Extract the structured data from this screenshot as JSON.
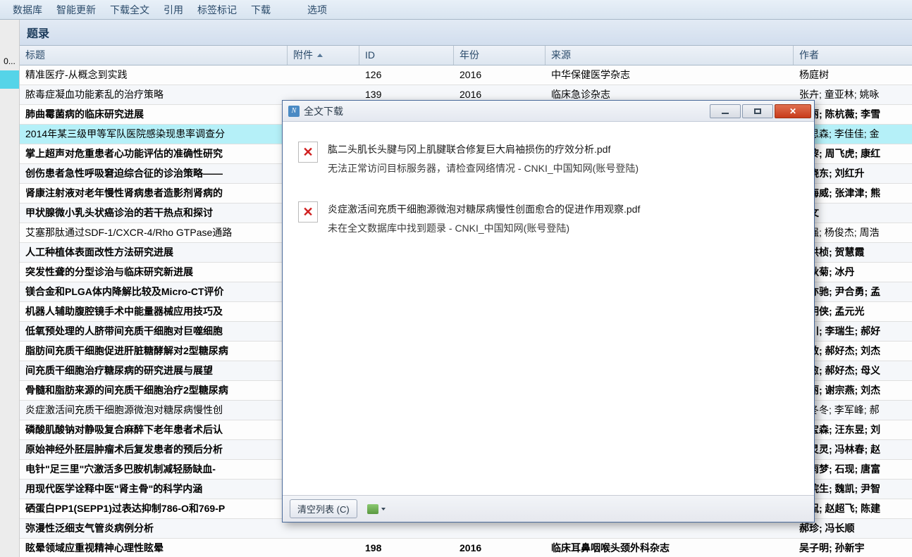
{
  "menu": {
    "items": [
      "数据库",
      "智能更新",
      "下载全文",
      "引用",
      "标签标记",
      "下载",
      "选项"
    ]
  },
  "sidebar": {
    "label": "0..."
  },
  "section": {
    "title": "题录"
  },
  "table": {
    "columns": {
      "title": "标题",
      "attachment": "附件",
      "id": "ID",
      "year": "年份",
      "source": "来源",
      "author": "作者"
    },
    "rows": [
      {
        "bold": false,
        "highlight": false,
        "title": "精准医疗-从概念到实践",
        "att": "",
        "id": "126",
        "year": "2016",
        "source": "中华保健医学杂志",
        "author": "杨庭树"
      },
      {
        "bold": false,
        "highlight": false,
        "title": "脓毒症凝血功能紊乱的治疗策略",
        "att": "",
        "id": "139",
        "year": "2016",
        "source": "临床急诊杂志",
        "author": "张卉; 童亚林; 姚咏"
      },
      {
        "bold": true,
        "highlight": false,
        "title": "肺曲霉菌病的临床研究进展",
        "att": "",
        "id": "",
        "year": "",
        "source": "",
        "author": "马丽; 陈杭薇; 李雪"
      },
      {
        "bold": false,
        "highlight": true,
        "title": "2014年某三级甲等军队医院感染现患率调查分",
        "att": "",
        "id": "",
        "year": "",
        "source": "",
        "author": "王思森; 李佳佳; 金"
      },
      {
        "bold": true,
        "highlight": false,
        "title": "掌上超声对危重患者心功能评估的准确性研究",
        "att": "",
        "id": "",
        "year": "",
        "source": "",
        "author": "王黎; 周飞虎; 康红"
      },
      {
        "bold": true,
        "highlight": false,
        "title": "创伤患者急性呼吸窘迫综合征的诊治策略——",
        "att": "",
        "id": "",
        "year": "",
        "source": "",
        "author": "赵晓东; 刘红升"
      },
      {
        "bold": true,
        "highlight": false,
        "title": "肾康注射液对老年慢性肾病患者造影剂肾病的",
        "att": "",
        "id": "",
        "year": "",
        "source": "",
        "author": "陈海威; 张津津; 熊"
      },
      {
        "bold": true,
        "highlight": false,
        "title": "甲状腺微小乳头状癌诊治的若干热点和探讨",
        "att": "",
        "id": "",
        "year": "",
        "source": "",
        "author": "田文"
      },
      {
        "bold": false,
        "highlight": false,
        "title": "艾塞那肽通过SDF-1/CXCR-4/Rho GTPase通路",
        "att": "",
        "id": "",
        "year": "",
        "source": "",
        "author": "马强; 杨俊杰; 周浩"
      },
      {
        "bold": true,
        "highlight": false,
        "title": "人工种植体表面改性方法研究进展",
        "att": "",
        "id": "",
        "year": "",
        "source": "",
        "author": "蔡洪桢; 贺慧霞"
      },
      {
        "bold": true,
        "highlight": false,
        "title": "突发性聋的分型诊治与临床研究新进展",
        "att": "",
        "id": "",
        "year": "",
        "source": "",
        "author": "王秋菊; 冰丹"
      },
      {
        "bold": true,
        "highlight": false,
        "title": "镁合金和PLGA体内降解比较及Micro-CT评价",
        "att": "",
        "id": "",
        "year": "",
        "source": "",
        "author": "徐亦驰; 尹合勇; 孟"
      },
      {
        "bold": true,
        "highlight": false,
        "title": "机器人辅助腹腔镜手术中能量器械应用技巧及",
        "att": "",
        "id": "",
        "year": "",
        "source": "",
        "author": "叶明侠; 孟元光"
      },
      {
        "bold": true,
        "highlight": false,
        "title": "低氧预处理的人脐带间充质干细胞对巨噬细胞",
        "att": "",
        "id": "",
        "year": "",
        "source": "",
        "author": "徐川; 李瑞生; 郝好"
      },
      {
        "bold": true,
        "highlight": false,
        "title": "脂肪间充质干细胞促进肝脏糖酵解对2型糖尿病",
        "att": "",
        "id": "",
        "year": "",
        "source": "",
        "author": "谢敏; 郝好杰; 刘杰"
      },
      {
        "bold": true,
        "highlight": false,
        "title": "间充质干细胞治疗糖尿病的研究进展与展望",
        "att": "",
        "id": "",
        "year": "",
        "source": "",
        "author": "程愈; 郝好杰; 母义"
      },
      {
        "bold": true,
        "highlight": false,
        "title": "骨髓和脂肪来源的间充质干细胞治疗2型糖尿病",
        "att": "",
        "id": "",
        "year": "",
        "source": "",
        "author": "臧丽; 谢宗燕; 刘杰"
      },
      {
        "bold": false,
        "highlight": false,
        "title": "炎症激活间充质干细胞源微泡对糖尿病慢性创",
        "att": "",
        "id": "",
        "year": "",
        "source": "",
        "author": "臧冬冬; 李军峰; 郝"
      },
      {
        "bold": true,
        "highlight": false,
        "title": "磷酸肌酸钠对静吸复合麻醉下老年患者术后认",
        "att": "",
        "id": "",
        "year": "",
        "source": "",
        "author": "贾宝森; 汪东昱; 刘"
      },
      {
        "bold": true,
        "highlight": false,
        "title": "原始神经外胚层肿瘤术后复发患者的预后分析",
        "att": "",
        "id": "",
        "year": "",
        "source": "",
        "author": "高灵灵; 冯林春; 赵"
      },
      {
        "bold": true,
        "highlight": false,
        "title": "电针\"足三里\"穴激活多巴胺机制减轻肠缺血-",
        "att": "",
        "id": "",
        "year": "",
        "source": "",
        "author": "李雨梦; 石现; 唐富"
      },
      {
        "bold": true,
        "highlight": false,
        "title": "用现代医学诠释中医\"肾主骨\"的科学内涵",
        "att": "",
        "id": "",
        "year": "",
        "source": "",
        "author": "谢院生; 魏凯; 尹智"
      },
      {
        "bold": true,
        "highlight": false,
        "title": "硒蛋白PP1(SEPP1)过表达抑制786-O和769-P",
        "att": "",
        "id": "",
        "year": "",
        "source": "",
        "author": "刘侃; 赵超飞; 陈建"
      },
      {
        "bold": true,
        "highlight": false,
        "title": "弥漫性泛细支气管炎病例分析",
        "att": "",
        "id": "",
        "year": "",
        "source": "",
        "author": "郝珍; 冯长顺"
      },
      {
        "bold": true,
        "highlight": false,
        "title": "眩晕领域应重视精神心理性眩晕",
        "att": "",
        "id": "198",
        "year": "2016",
        "source": "临床耳鼻咽喉头颈外科杂志",
        "author": "吴子明; 孙新宇"
      }
    ]
  },
  "dialog": {
    "title": "全文下载",
    "items": [
      {
        "file": "肱二头肌长头腱与冈上肌腱联合修复巨大肩袖损伤的疗效分析.pdf",
        "status": "无法正常访问目标服务器，请检查网络情况  -  CNKI_中国知网(账号登陆)"
      },
      {
        "file": "炎症激活间充质干细胞源微泡对糖尿病慢性创面愈合的促进作用观察.pdf",
        "status": "未在全文数据库中找到题录  -  CNKI_中国知网(账号登陆)"
      }
    ],
    "footer": {
      "clear": "清空列表 (C)"
    }
  }
}
